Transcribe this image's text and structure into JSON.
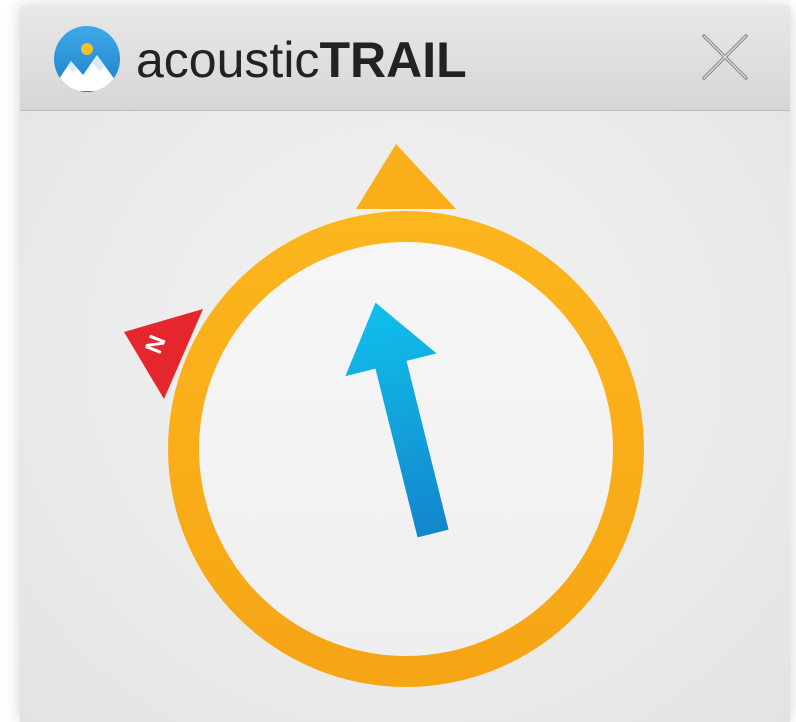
{
  "app": {
    "title_light": "acoustic",
    "title_bold": "TRAIL"
  },
  "compass": {
    "north_label": "N",
    "ring_color": "#FBB21C",
    "pointer_color": "#F9A915",
    "north_color": "#E8262C",
    "arrow_color": "#1AA8DF"
  },
  "icons": {
    "logo": "mountain-sun-icon",
    "close": "close-icon"
  }
}
